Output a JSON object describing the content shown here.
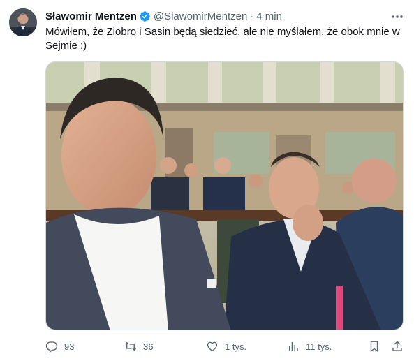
{
  "author": {
    "name": "Sławomir Mentzen",
    "handle": "@SlawomirMentzen",
    "separator": "·",
    "time": "4 min",
    "verified": true
  },
  "tweet": {
    "text": "Mówiłem, że Ziobro i Sasin będą siedzieć, ale nie myślałem, że obok mnie w Sejmie :)"
  },
  "metrics": {
    "replies": "93",
    "reposts": "36",
    "likes": "1 tys.",
    "views": "11 tys."
  },
  "icons": {
    "more": "more-icon",
    "reply": "reply-icon",
    "repost": "repost-icon",
    "like": "heart-icon",
    "views": "views-icon",
    "bookmark": "bookmark-icon",
    "share": "share-icon",
    "verified": "verified-badge-icon"
  },
  "colors": {
    "text": "#0f1419",
    "secondary": "#536471",
    "verified": "#1d9bf0"
  }
}
